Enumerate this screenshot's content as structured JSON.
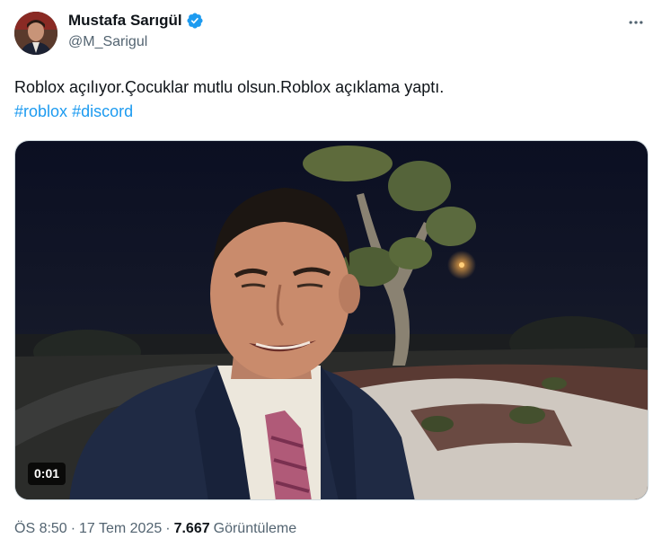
{
  "author": {
    "display_name": "Mustafa Sarıgül",
    "handle": "@M_Sarigul",
    "avatar_icon": "profile-photo",
    "verified_icon": "verified-badge-icon"
  },
  "tweet": {
    "text": "Roblox açılıyor.Çocuklar mutlu olsun.Roblox açıklama yaptı.",
    "hashtags": [
      "#roblox",
      "#discord"
    ]
  },
  "media": {
    "type": "video",
    "duration": "0:01"
  },
  "meta": {
    "time": "ÖS 8:50",
    "separator": "·",
    "date": "17 Tem 2025",
    "views_count": "7.667",
    "views_label": "Görüntüleme"
  },
  "colors": {
    "link": "#1d9bf0",
    "secondary_text": "#536471",
    "primary_text": "#0f1419",
    "verified": "#1d9bf0"
  }
}
